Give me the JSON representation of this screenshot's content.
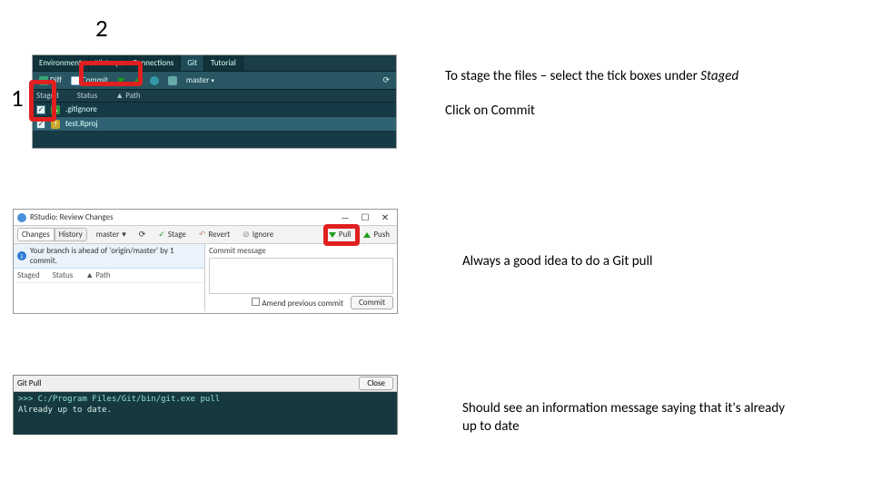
{
  "callouts": {
    "one": "1",
    "two": "2"
  },
  "instructions": {
    "stage_line": "To stage the files – select the tick boxes under",
    "stage_em": "Staged",
    "commit": "Click on Commit",
    "pull_tip": "Always a good idea to do a Git pull",
    "uptodate": "Should see an information message saying that it's already up to date"
  },
  "git_pane": {
    "tabs": [
      "Environment",
      "History",
      "Connections",
      "Git",
      "Tutorial"
    ],
    "toolbar": {
      "diff": "Diff",
      "commit": "Commit",
      "branch": "master"
    },
    "columns": {
      "staged": "Staged",
      "status": "Status",
      "path": "Path"
    },
    "rows": [
      {
        "checked": true,
        "status": "A",
        "status_class": "st-a",
        "path": ".gitignore"
      },
      {
        "checked": true,
        "status": "?",
        "status_class": "st-q",
        "path": "test.Rproj"
      }
    ]
  },
  "review": {
    "title": "RStudio: Review Changes",
    "tabs": {
      "changes": "Changes",
      "history": "History"
    },
    "branch": "master",
    "stage": "Stage",
    "revert": "Revert",
    "ignore": "Ignore",
    "pull": "Pull",
    "push": "Push",
    "info": "Your branch is ahead of 'origin/master' by 1 commit.",
    "cols": {
      "staged": "Staged",
      "status": "Status",
      "path": "Path"
    },
    "msg_label": "Commit message",
    "amend": "Amend previous commit",
    "commit_btn": "Commit"
  },
  "pull_win": {
    "title": "Git Pull",
    "close": "Close",
    "line1": ">>> C:/Program Files/Git/bin/git.exe pull",
    "line2": "Already up to date."
  }
}
